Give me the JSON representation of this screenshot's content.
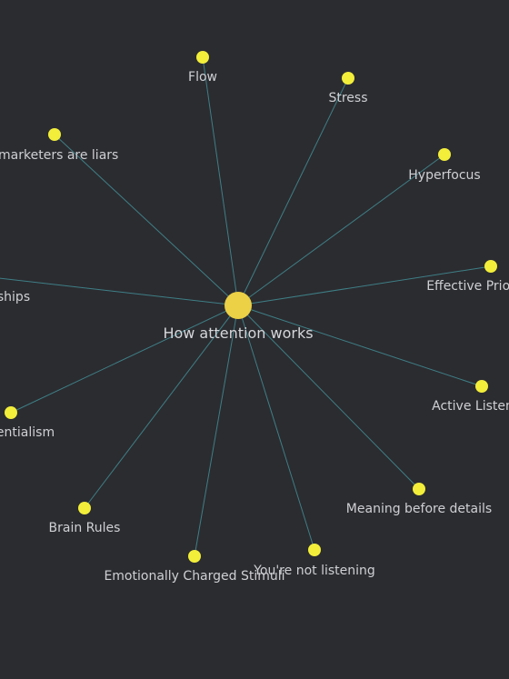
{
  "graph": {
    "center": {
      "label": "How attention works",
      "color": "#ecd045"
    },
    "node_color": "#f2ee3a",
    "edge_color": "#3e7f86",
    "background_color": "#2b2c30",
    "nodes": [
      {
        "id": "flow",
        "label": "Flow"
      },
      {
        "id": "stress",
        "label": "Stress"
      },
      {
        "id": "marketers",
        "label": "l marketers are liars"
      },
      {
        "id": "hyperfocus",
        "label": "Hyperfocus"
      },
      {
        "id": "effective-priorities",
        "label": "Effective Priori"
      },
      {
        "id": "relationships",
        "label": "ships"
      },
      {
        "id": "active-listening",
        "label": "Active Listen"
      },
      {
        "id": "existentialism",
        "label": "entialism"
      },
      {
        "id": "meaning-before-details",
        "label": "Meaning before details"
      },
      {
        "id": "brain-rules",
        "label": "Brain Rules"
      },
      {
        "id": "emotionally-charged-stimuli",
        "label": "Emotionally Charged Stimuli"
      },
      {
        "id": "not-listening",
        "label": "You're not listening"
      }
    ]
  }
}
